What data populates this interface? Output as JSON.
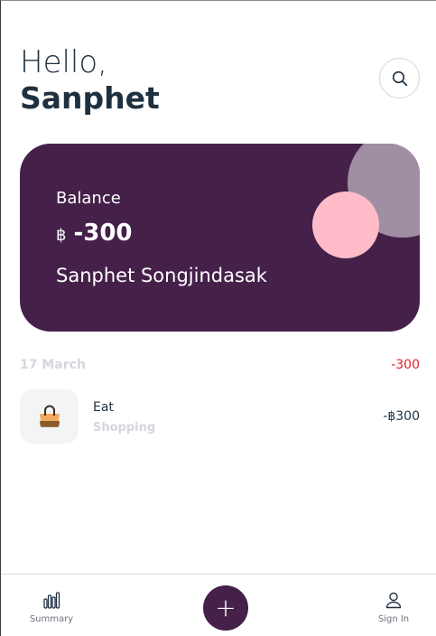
{
  "header": {
    "greeting": "Hello,",
    "user_name": "Sanphet"
  },
  "search": {
    "icon": "search-icon"
  },
  "balance_card": {
    "label": "Balance",
    "currency_symbol": "฿",
    "amount": "-300",
    "holder_name": "Sanphet Songjindasak",
    "colors": {
      "background": "#45214a",
      "circle_large": "#a08fa2",
      "circle_small": "#ffbcc8"
    }
  },
  "transactions": {
    "date": "17 March",
    "day_total": "-300",
    "items": [
      {
        "title": "Eat",
        "category": "Shopping",
        "amount": "-฿300",
        "icon": "handbag-icon"
      }
    ]
  },
  "bottom_nav": {
    "summary_label": "Summary",
    "add_label": "+",
    "signin_label": "Sign In"
  },
  "colors": {
    "accent": "#45214a",
    "negative": "#e0232b",
    "muted": "#d3d6dc"
  }
}
